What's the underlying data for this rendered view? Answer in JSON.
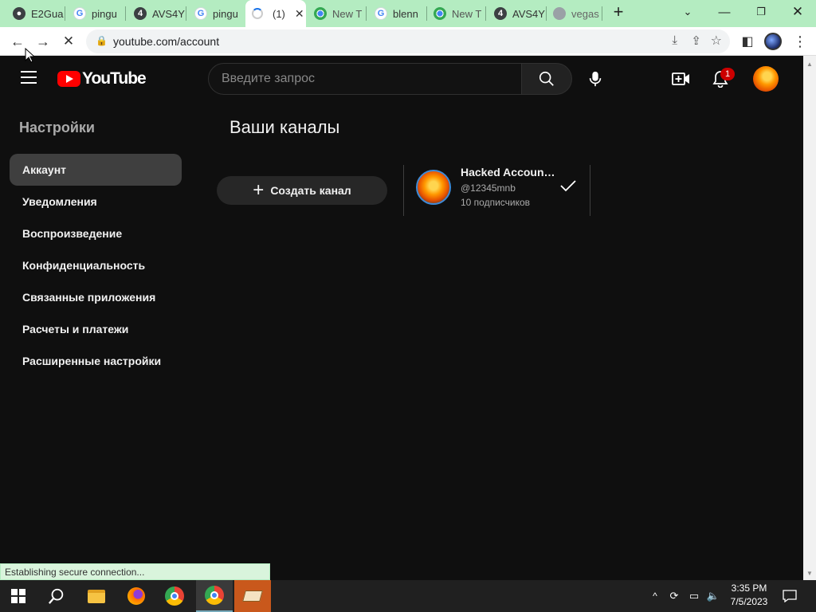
{
  "browser": {
    "tabs": [
      {
        "title": "E2Gua",
        "icon": "chrome-dark-icon"
      },
      {
        "title": "pingu",
        "icon": "google-icon"
      },
      {
        "title": "AVS4Y",
        "icon": "avs-icon"
      },
      {
        "title": "pingu",
        "icon": "google-icon"
      },
      {
        "title": "(1)",
        "icon": "loading-spinner"
      },
      {
        "title": "New T",
        "icon": "chrome-icon"
      },
      {
        "title": "blenn",
        "icon": "google-icon"
      },
      {
        "title": "New T",
        "icon": "chrome-icon"
      },
      {
        "title": "AVS4Y",
        "icon": "avs-icon"
      },
      {
        "title": "vegas",
        "icon": "globe-icon"
      }
    ],
    "url": "youtube.com/account",
    "status": "Establishing secure connection...",
    "tabstrip_color": "#b4ecc1"
  },
  "youtube": {
    "logo_text": "YouTube",
    "search_placeholder": "Введите запрос",
    "notification_count": "1",
    "settings_title": "Настройки",
    "nav": [
      "Аккаунт",
      "Уведомления",
      "Воспроизведение",
      "Конфиденциальность",
      "Связанные приложения",
      "Расчеты и платежи",
      "Расширенные настройки"
    ],
    "selected_nav": "Аккаунт",
    "channels_title": "Ваши каналы",
    "create_channel": "Создать канал",
    "channel": {
      "name": "Hacked Account ...",
      "handle": "@12345mnb",
      "subscribers": "10 подписчиков"
    }
  },
  "taskbar": {
    "time": "3:35 PM",
    "date": "7/5/2023"
  }
}
